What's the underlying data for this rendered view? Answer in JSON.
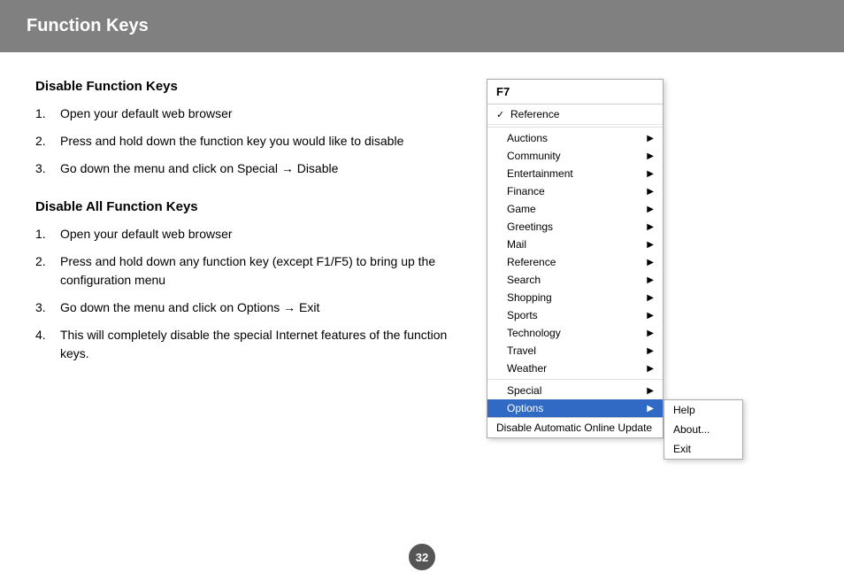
{
  "header": {
    "title": "Function Keys",
    "bg_color": "#808080"
  },
  "section1": {
    "title": "Disable Function Keys",
    "steps": [
      {
        "num": "1.",
        "text": "Open your default web browser"
      },
      {
        "num": "2.",
        "text": "Press and hold down the function key you would like to disable"
      },
      {
        "num": "3.",
        "text": "Go down the menu and click on Special → Disable"
      }
    ]
  },
  "section2": {
    "title": "Disable All Function Keys",
    "steps": [
      {
        "num": "1.",
        "text": "Open your default web browser"
      },
      {
        "num": "2.",
        "text": "Press and hold down any function key (except F1/F5) to bring up the configuration menu"
      },
      {
        "num": "3.",
        "text": "Go down the menu and click on Options → Exit"
      },
      {
        "num": "4.",
        "text": "This will completely disable the special Internet features of the function keys."
      }
    ]
  },
  "menu": {
    "header": "F7",
    "checked_item": "Reference",
    "items": [
      {
        "label": "Auctions",
        "has_arrow": true
      },
      {
        "label": "Community",
        "has_arrow": true
      },
      {
        "label": "Entertainment",
        "has_arrow": true
      },
      {
        "label": "Finance",
        "has_arrow": true
      },
      {
        "label": "Game",
        "has_arrow": true
      },
      {
        "label": "Greetings",
        "has_arrow": true
      },
      {
        "label": "Mail",
        "has_arrow": true
      },
      {
        "label": "Reference",
        "has_arrow": true
      },
      {
        "label": "Search",
        "has_arrow": true
      },
      {
        "label": "Shopping",
        "has_arrow": true
      },
      {
        "label": "Sports",
        "has_arrow": true
      },
      {
        "label": "Technology",
        "has_arrow": true
      },
      {
        "label": "Travel",
        "has_arrow": true
      },
      {
        "label": "Weather",
        "has_arrow": true
      }
    ],
    "special_item": "Special",
    "options_item": "Options",
    "disable_label": "Disable Automatic Online Update",
    "submenu_items": [
      "Help",
      "About...",
      "Exit"
    ]
  },
  "page_number": "32"
}
